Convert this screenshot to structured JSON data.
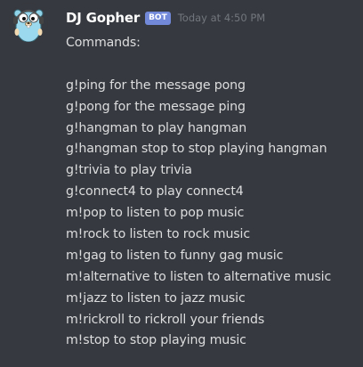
{
  "author": {
    "name": "DJ Gopher",
    "tag": "BOT",
    "timestamp": "Today at 4:50 PM",
    "avatar_icon": "gopher-avatar-icon"
  },
  "message": {
    "title": "Commands:",
    "commands": [
      "g!ping for the message pong",
      "g!pong for the message ping",
      "g!hangman to play hangman",
      "g!hangman stop to stop playing hangman",
      "g!trivia to play trivia",
      "g!connect4 to play connect4",
      "m!pop to listen to pop music",
      "m!rock to listen to rock music",
      "m!gag to listen to funny gag music",
      "m!alternative to listen to alternative music",
      "m!jazz to listen to jazz music",
      "m!rickroll to rickroll your friends",
      "m!stop to stop playing music"
    ]
  },
  "colors": {
    "background": "#36393f",
    "username": "#ffffff",
    "bot_tag": "#7289da",
    "timestamp": "#72767d",
    "text": "#dcddde"
  }
}
